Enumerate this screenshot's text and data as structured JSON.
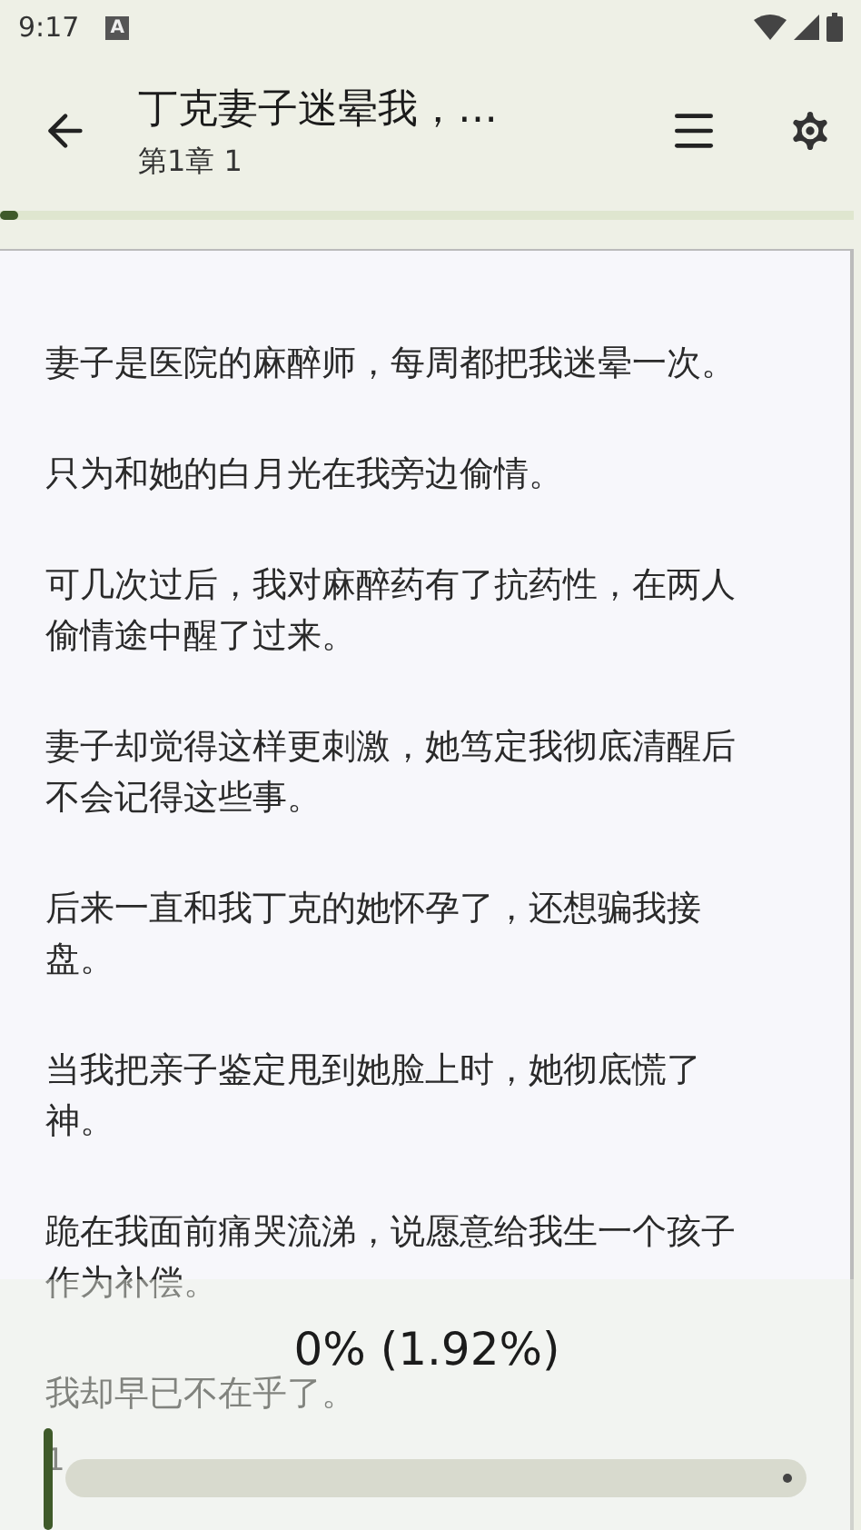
{
  "status_bar": {
    "time": "9:17",
    "notification": "A"
  },
  "header": {
    "title": "丁克妻子迷晕我，…",
    "subtitle": "第1章 1",
    "progress": {
      "level": 0
    }
  },
  "paragraphs": [
    "妻子是医院的麻醉师，每周都把我迷晕一次。",
    "只为和她的白月光在我旁边偷情。",
    "可几次过后，我对麻醉药有了抗药性，在两人偷情途中醒了过来。",
    "妻子却觉得这样更刺激，她笃定我彻底清醒后不会记得这些事。",
    "后来一直和我丁克的她怀孕了，还想骗我接盘。",
    "当我把亲子鉴定甩到她脸上时，她彻底慌了神。",
    "跪在我面前痛哭流涕，说愿意给我生一个孩子作为补偿。",
    "我却早已不在乎了。"
  ],
  "page_number": "1",
  "bottom_panel": {
    "reading": "0% (1.92%)",
    "slider": {
      "level": 0
    }
  }
}
